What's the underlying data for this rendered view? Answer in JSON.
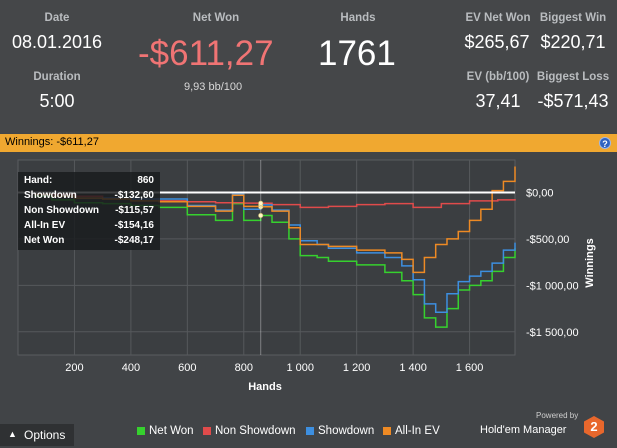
{
  "stats": {
    "date_label": "Date",
    "date_value": "08.01.2016",
    "duration_label": "Duration",
    "duration_value": "5:00",
    "net_won_label": "Net Won",
    "net_won_value": "-$611,27",
    "bb100_value": "9,93 bb/100",
    "hands_label": "Hands",
    "hands_value": "1761",
    "ev_net_won_label": "EV Net Won",
    "ev_net_won_value": "$265,67",
    "biggest_win_label": "Biggest Win",
    "biggest_win_value": "$220,71",
    "ev_bb100_label": "EV (bb/100)",
    "ev_bb100_value": "37,41",
    "biggest_loss_label": "Biggest Loss",
    "biggest_loss_value": "-$571,43"
  },
  "titlebar": {
    "title": "Winnings:  -$611,27",
    "help": "?"
  },
  "tooltip": {
    "rows": [
      {
        "k": "Hand:",
        "v": "860"
      },
      {
        "k": "Showdown",
        "v": "-$132,60"
      },
      {
        "k": "Non Showdown",
        "v": "-$115,57"
      },
      {
        "k": "All-In EV",
        "v": "-$154,16"
      },
      {
        "k": "Net Won",
        "v": "-$248,17"
      }
    ]
  },
  "footer": {
    "options_label": "Options",
    "powered_by": "Powered by",
    "brand": "Hold'em Manager",
    "brand_num": "2"
  },
  "colors": {
    "net_won": "#36d12e",
    "non_showdown": "#e04b4b",
    "showdown": "#3d8fe0",
    "allin_ev": "#ee8a24",
    "net_won_text": "#f07474",
    "title_bar": "#f0a830"
  },
  "chart_data": {
    "type": "line",
    "xlabel": "Hands",
    "ylabel": "Winnings",
    "xlim": [
      0,
      1761
    ],
    "ylim": [
      -1750,
      350
    ],
    "xticks": [
      200,
      400,
      600,
      800,
      1000,
      1200,
      1400,
      1600
    ],
    "xtick_labels": [
      "200",
      "400",
      "600",
      "800",
      "1 000",
      "1 200",
      "1 400",
      "1 600"
    ],
    "yticks": [
      0,
      -500,
      -1000,
      -1500
    ],
    "ytick_labels": [
      "$0,00",
      "-$500,00",
      "-$1 000,00",
      "-$1 500,00"
    ],
    "grid": true,
    "legend_position": "bottom",
    "series": [
      {
        "name": "Net Won",
        "color": "#36d12e",
        "x": [
          0,
          60,
          120,
          200,
          300,
          400,
          500,
          600,
          700,
          760,
          800,
          860,
          900,
          960,
          1000,
          1060,
          1100,
          1200,
          1300,
          1360,
          1400,
          1440,
          1480,
          1520,
          1560,
          1600,
          1640,
          1680,
          1720,
          1761
        ],
        "y": [
          0,
          -40,
          -80,
          -110,
          -120,
          -140,
          -160,
          -240,
          -300,
          -120,
          -300,
          -248,
          -320,
          -500,
          -680,
          -700,
          -740,
          -780,
          -860,
          -950,
          -1100,
          -1350,
          -1450,
          -1250,
          -1050,
          -1000,
          -950,
          -850,
          -700,
          -600
        ]
      },
      {
        "name": "Non Showdown",
        "color": "#e04b4b",
        "x": [
          0,
          100,
          200,
          300,
          400,
          500,
          600,
          700,
          800,
          860,
          900,
          1000,
          1100,
          1200,
          1300,
          1400,
          1500,
          1600,
          1700,
          1761
        ],
        "y": [
          0,
          -20,
          -40,
          -60,
          -70,
          -90,
          -100,
          -110,
          -115,
          -116,
          -130,
          -160,
          -150,
          -130,
          -120,
          -160,
          -120,
          -90,
          -80,
          -70
        ]
      },
      {
        "name": "Showdown",
        "color": "#3d8fe0",
        "x": [
          0,
          60,
          120,
          200,
          300,
          400,
          500,
          600,
          700,
          760,
          800,
          860,
          900,
          960,
          1000,
          1060,
          1100,
          1200,
          1300,
          1360,
          1400,
          1440,
          1480,
          1520,
          1560,
          1600,
          1640,
          1680,
          1720,
          1761
        ],
        "y": [
          0,
          -20,
          -40,
          -60,
          -60,
          -70,
          -70,
          -140,
          -190,
          -20,
          -180,
          -133,
          -190,
          -350,
          -520,
          -560,
          -600,
          -650,
          -700,
          -790,
          -940,
          -1200,
          -1290,
          -1090,
          -960,
          -900,
          -850,
          -760,
          -620,
          -540
        ]
      },
      {
        "name": "All-In EV",
        "color": "#ee8a24",
        "x": [
          0,
          60,
          120,
          200,
          300,
          400,
          500,
          600,
          700,
          760,
          800,
          860,
          900,
          960,
          1000,
          1060,
          1100,
          1200,
          1300,
          1360,
          1400,
          1440,
          1480,
          1520,
          1560,
          1600,
          1640,
          1680,
          1720,
          1761
        ],
        "y": [
          0,
          -20,
          -40,
          -60,
          -70,
          -90,
          -100,
          -150,
          -200,
          -30,
          -150,
          -154,
          -200,
          -380,
          -560,
          -560,
          -580,
          -620,
          -650,
          -720,
          -860,
          -700,
          -560,
          -500,
          -420,
          -300,
          -180,
          20,
          120,
          280
        ]
      }
    ]
  }
}
